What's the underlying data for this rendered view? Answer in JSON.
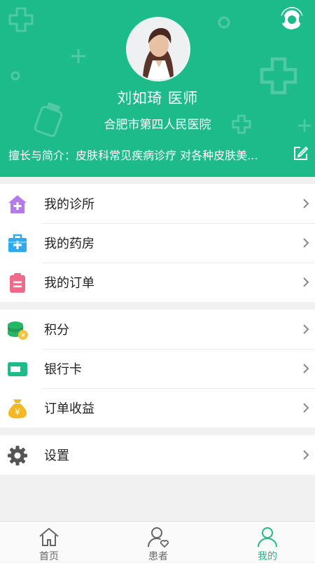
{
  "profile": {
    "name": "刘如琦",
    "title": "医师",
    "hospital": "合肥市第四人民医院",
    "intro": "擅长与简介：皮肤科常见疾病诊疗 对各种皮肤美..."
  },
  "menu_groups": [
    {
      "items": [
        {
          "label": "我的诊所",
          "icon": "clinic-house-icon",
          "color": "#b57bea"
        },
        {
          "label": "我的药房",
          "icon": "pharmacy-kit-icon",
          "color": "#2eaaf0"
        },
        {
          "label": "我的订单",
          "icon": "order-clipboard-icon",
          "color": "#ef6b8a"
        }
      ]
    },
    {
      "items": [
        {
          "label": "积分",
          "icon": "points-coins-icon",
          "color": "#23b765"
        },
        {
          "label": "银行卡",
          "icon": "bank-card-icon",
          "color": "#1dbb89"
        },
        {
          "label": "订单收益",
          "icon": "money-bag-icon",
          "color": "#f5b823"
        }
      ]
    },
    {
      "items": [
        {
          "label": "设置",
          "icon": "settings-gear-icon",
          "color": "#555555"
        }
      ]
    }
  ],
  "tabs": [
    {
      "label": "首页",
      "icon": "home-icon",
      "active": false
    },
    {
      "label": "患者",
      "icon": "patient-icon",
      "active": false
    },
    {
      "label": "我的",
      "icon": "profile-icon",
      "active": true
    }
  ],
  "colors": {
    "brand": "#1dbb89",
    "background": "#f1f1f1"
  }
}
